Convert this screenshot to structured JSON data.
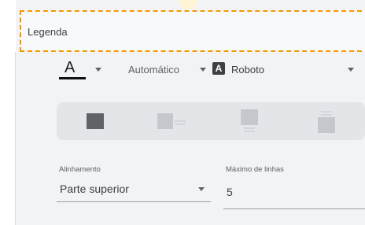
{
  "legend": {
    "label": "Legenda"
  },
  "text_style": {
    "font_color_glyph": "A",
    "font_color": "#111111",
    "font_size_value": "Automático",
    "font_badge_glyph": "A",
    "font_family_value": "Roboto"
  },
  "position_options": [
    {
      "icon": "legend-position-full-icon"
    },
    {
      "icon": "legend-position-left-icon"
    },
    {
      "icon": "legend-position-top-icon"
    },
    {
      "icon": "legend-position-bottom-icon"
    }
  ],
  "alignment": {
    "label": "Alinhamento",
    "value": "Parte superior"
  },
  "max_lines": {
    "label": "Máximo de linhas",
    "value": "5"
  },
  "colors": {
    "accent_dashed": "#f29900",
    "panel_bg": "#f1f3f4",
    "icon_dark": "#5f6368",
    "icon_light": "#c4c7cc"
  }
}
